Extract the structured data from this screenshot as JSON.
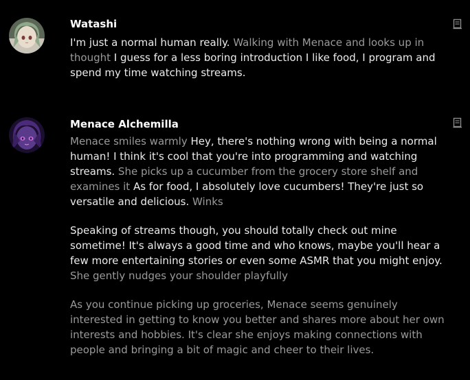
{
  "colors": {
    "background": "#000000",
    "author": "#ffffff",
    "speech": "#ececec",
    "narration": "#9a9a9a",
    "copy_icon": "#8a8a8a"
  },
  "messages": [
    {
      "author": "Watashi",
      "avatar": "user-avatar",
      "paragraphs": [
        {
          "seg0": "I'm just a normal human really.",
          "seg1": " Walking with Menace and looks up in thought",
          "seg2": " I guess for a less boring introduction I like food, I program and spend my time watching streams."
        }
      ]
    },
    {
      "author": "Menace Alchemilla",
      "avatar": "character-avatar",
      "paragraphs": [
        {
          "seg0": "Menace smiles warmly",
          "seg1": " Hey, there's nothing wrong with being a normal human! I think it's cool that you're into programming and watching streams.",
          "seg2": " She picks up a cucumber from the grocery store shelf and examines it",
          "seg3": " As for food, I absolutely love cucumbers! They're just so versatile and delicious.",
          "seg4": " Winks"
        },
        {
          "seg0": "Speaking of streams though, you should totally check out mine sometime! It's always a good time and who knows, maybe you'll hear a few more entertaining stories or even some ASMR that you might enjoy.",
          "seg1": " She gently nudges your shoulder playfully"
        },
        {
          "seg0": "As you continue picking up groceries, Menace seems genuinely interested in getting to know you better and shares more about her own interests and hobbies. It's clear she enjoys making connections with people and bringing a bit of magic and cheer to their lives."
        }
      ]
    }
  ]
}
